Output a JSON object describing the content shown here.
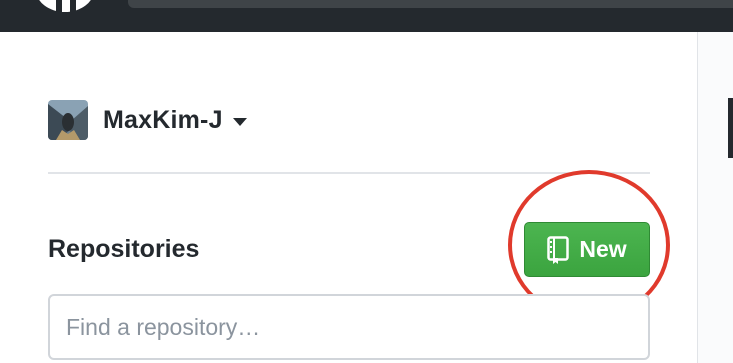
{
  "header": {
    "logo_icon": "github-octocat-icon"
  },
  "account": {
    "username": "MaxKim-J",
    "caret_icon": "caret-down-icon"
  },
  "repositories": {
    "heading": "Repositories",
    "new_button_label": "New",
    "new_button_icon": "repo-icon",
    "search_placeholder": "Find a repository…"
  },
  "colors": {
    "header_bg": "#24292e",
    "new_button_green": "#3ba43f",
    "highlight_red": "#e03a2c",
    "text_dark": "#24292e"
  }
}
